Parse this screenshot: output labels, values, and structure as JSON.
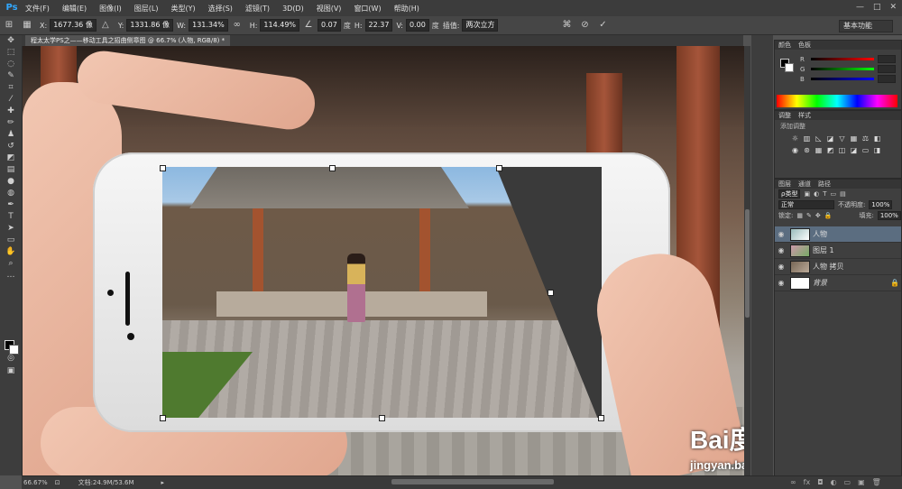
{
  "app": {
    "logo": "Ps"
  },
  "menu": [
    "文件(F)",
    "编辑(E)",
    "图像(I)",
    "图层(L)",
    "类型(Y)",
    "选择(S)",
    "滤镜(T)",
    "3D(D)",
    "视图(V)",
    "窗口(W)",
    "帮助(H)"
  ],
  "window_controls": {
    "minimize": "—",
    "maximize": "□",
    "close": "✕"
  },
  "options": {
    "x_label": "X:",
    "x_value": "1677.36 像",
    "y_label": "Y:",
    "y_value": "1331.86 像",
    "w_label": "W:",
    "w_value": "131.34%",
    "h_label": "H:",
    "h_value": "114.49%",
    "angle_value": "0.07",
    "angle_unit": "度",
    "hskew_label": "H:",
    "hskew_value": "22.37",
    "vskew_label": "V:",
    "vskew_value": "0.00",
    "vskew_unit": "度",
    "hskew_unit": "度",
    "interp_label": "插值:",
    "interp_value": "两次立方",
    "workspace": "基本功能"
  },
  "document_tab": {
    "title": "程太太学PS之——移动工具之招曲侧章图 @ 66.7% (人物, RGB/8) *"
  },
  "color_panel": {
    "tabs": [
      "颜色",
      "色板"
    ],
    "r_label": "R",
    "g_label": "G",
    "b_label": "B"
  },
  "adjust_panel": {
    "tabs": [
      "调整",
      "样式"
    ],
    "title": "添加调整"
  },
  "layers_panel": {
    "tabs": [
      "图层",
      "通道",
      "路径"
    ],
    "filter_label": "ρ类型",
    "blend_mode": "正常",
    "opacity_label": "不透明度:",
    "opacity_value": "100%",
    "lock_label": "锁定:",
    "fill_label": "填充:",
    "fill_value": "100%",
    "layers": [
      {
        "name": "人物",
        "selected": true
      },
      {
        "name": "图层 1",
        "selected": false
      },
      {
        "name": "人物 拷贝",
        "selected": false
      },
      {
        "name": "背景",
        "selected": false,
        "locked": true
      }
    ]
  },
  "status": {
    "zoom": "66.67%",
    "doc_info": "文档:24.9M/53.6M"
  },
  "watermark": {
    "brand": "Bai度经验",
    "url": "jingyan.baidu.com"
  },
  "colors": {
    "selected_layer": "#5b6d80",
    "ps_blue": "#31a8ff"
  }
}
